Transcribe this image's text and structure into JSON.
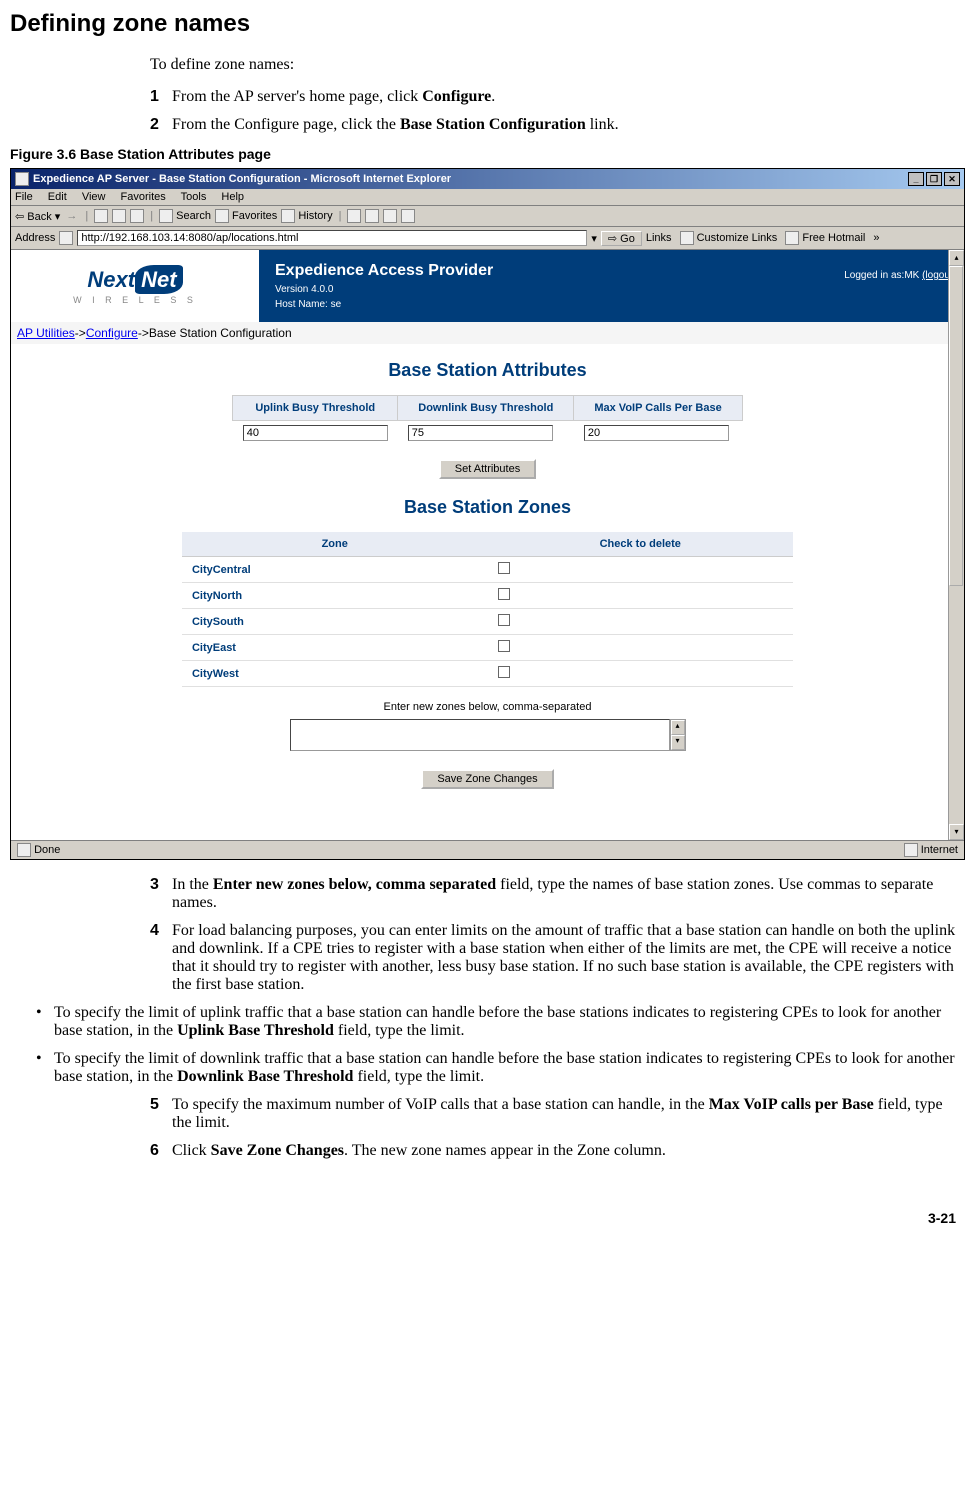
{
  "doc": {
    "h1": "Defining zone names",
    "intro": "To define zone names:",
    "steps": {
      "s1": {
        "num": "1",
        "pre": "From the AP server's home page, click ",
        "bold": "Configure",
        "post": "."
      },
      "s2": {
        "num": "2",
        "pre": "From the Configure page, click the ",
        "bold": "Base Station Configuration",
        "post": " link."
      },
      "s3": {
        "num": "3",
        "pre": "In the ",
        "bold": "Enter new zones below, comma separated",
        "post": " field, type the names of base station zones. Use commas to separate names."
      },
      "s4": {
        "num": "4",
        "text": "For load balancing purposes, you can enter limits on the amount of traffic that a base station can handle on both the uplink and downlink. If a CPE tries to register with a base station when either of the limits are met, the CPE will receive a notice that it should try to register with another, less busy base station. If no such base station is available, the CPE registers with the first base station."
      },
      "b1": {
        "pre": "To specify the limit of uplink traffic that a base station can handle before the base stations indicates to registering CPEs to look for another base station, in the ",
        "bold": "Uplink Base Threshold",
        "post": " field, type the limit."
      },
      "b2": {
        "pre": "To specify the limit of downlink traffic that a base station can handle before the base station indicates to registering CPEs to look for another base station, in the ",
        "bold": "Downlink Base Threshold",
        "post": " field, type the limit."
      },
      "s5": {
        "num": "5",
        "pre": "To specify the maximum number of VoIP calls that a base station can handle, in the ",
        "bold": "Max VoIP calls per Base",
        "post": " field, type the limit."
      },
      "s6": {
        "num": "6",
        "pre": "Click ",
        "bold": "Save Zone Changes",
        "post": ". The new zone names appear in the Zone column."
      }
    },
    "figure_caption": "Figure 3.6   Base Station Attributes page",
    "page_num": "3-21"
  },
  "ie": {
    "title": "Expedience AP Server - Base Station Configuration - Microsoft Internet Explorer",
    "menu": {
      "file": "File",
      "edit": "Edit",
      "view": "View",
      "favorites": "Favorites",
      "tools": "Tools",
      "help": "Help"
    },
    "toolbar": {
      "back": "Back",
      "search": "Search",
      "fav": "Favorites",
      "history": "History"
    },
    "address_label": "Address",
    "address_value": "http://192.168.103.14:8080/ap/locations.html",
    "go": "Go",
    "links_label": "Links",
    "links": {
      "customize": "Customize Links",
      "hotmail": "Free Hotmail"
    },
    "status_left": "Done",
    "status_right": "Internet"
  },
  "app": {
    "logo_main_a": "Next",
    "logo_main_b": "Net",
    "logo_sub": "W I R E L E S S",
    "banner_title": "Expedience Access Provider",
    "banner_version": "Version 4.0.0",
    "banner_host": "Host Name: se",
    "login_text_pre": "Logged in as:",
    "login_user": "MK",
    "login_logout": "(logout)",
    "breadcrumb": {
      "a": "AP Utilities",
      "b": "Configure",
      "c": "Base Station Configuration"
    },
    "section_attr": "Base Station Attributes",
    "section_zones": "Base Station Zones",
    "attr_headers": {
      "uplink": "Uplink Busy Threshold",
      "downlink": "Downlink Busy Threshold",
      "voip": "Max VoIP Calls Per Base"
    },
    "attr_values": {
      "uplink": "40",
      "downlink": "75",
      "voip": "20"
    },
    "btn_set_attr": "Set Attributes",
    "zone_headers": {
      "zone": "Zone",
      "delete": "Check to delete"
    },
    "zones": {
      "z0": "CityCentral",
      "z1": "CityNorth",
      "z2": "CitySouth",
      "z3": "CityEast",
      "z4": "CityWest"
    },
    "new_zones_label": "Enter new zones below, comma-separated",
    "btn_save": "Save Zone Changes"
  }
}
